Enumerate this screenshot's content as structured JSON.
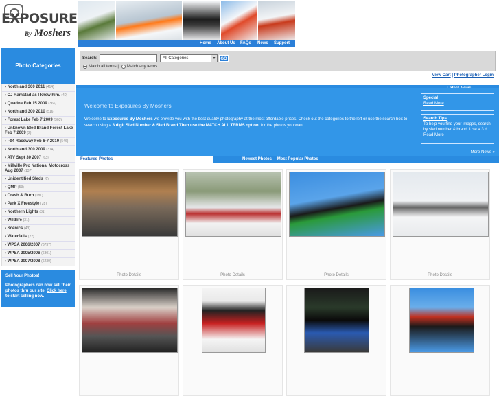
{
  "logo": {
    "line1": "EXPOSURES",
    "by": "By",
    "line2": "Moshers"
  },
  "nav": {
    "items": [
      "Home",
      "About Us",
      "FAQs",
      "News",
      "Support"
    ]
  },
  "sidebar": {
    "heading": "Photo Categories",
    "items": [
      {
        "label": "Northland 300 2011",
        "count": "(414)"
      },
      {
        "label": "CJ Ramstad as I knew him.",
        "count": "(40)"
      },
      {
        "label": "Quadna Feb 15 2009",
        "count": "(366)"
      },
      {
        "label": "Northland 300 2010",
        "count": "(516)"
      },
      {
        "label": "Forest Lake Feb 7 2009",
        "count": "(303)"
      },
      {
        "label": "Unknown Sled Brand Forest Lake Feb 7 2009",
        "count": "(2)"
      },
      {
        "label": "I-94 Raceway Feb 6-7 2010",
        "count": "(546)"
      },
      {
        "label": "Northland 300 2009",
        "count": "(314)"
      },
      {
        "label": "ATV Sept 30 2007",
        "count": "(63)"
      },
      {
        "label": "Millville Pro National Motocross Aug 2007",
        "count": "(137)"
      },
      {
        "label": "Unidentified Sleds",
        "count": "(6)"
      },
      {
        "label": "QMP",
        "count": "(53)"
      },
      {
        "label": "Crash & Burn",
        "count": "(181)"
      },
      {
        "label": "Park X Freestyle",
        "count": "(28)"
      },
      {
        "label": "Northern Lights",
        "count": "(31)"
      },
      {
        "label": "Wildlife",
        "count": "(31)"
      },
      {
        "label": "Scenics",
        "count": "(43)"
      },
      {
        "label": "Waterfalls",
        "count": "(22)"
      },
      {
        "label": "WPSA 2006/2007",
        "count": "(6737)"
      },
      {
        "label": "WPSA 2005/2006",
        "count": "(6801)"
      },
      {
        "label": "WPSA 2007/2008",
        "count": "(6230)"
      }
    ],
    "sell": {
      "title": "Sell Your Photos!",
      "text": "Photographers can now sell their photos thru our site.",
      "link": "Click here",
      "tail": "to start selling now."
    }
  },
  "search": {
    "label": "Search:",
    "value": "",
    "category": "All Categories",
    "go": "GO",
    "opt_all": "Match all terms |",
    "opt_any": "Match any terms"
  },
  "userlinks": {
    "cart": "View Cart",
    "sep": " | ",
    "login": "Photographer Login"
  },
  "news": {
    "heading": "Latest News",
    "item1_title": "Special",
    "item1_link": "Read More",
    "item2_title": "Search Tips",
    "item2_text": "To help you find your images, search by sled number & brand. Use a 3 d...",
    "item2_link": "Read More",
    "more": "More News »"
  },
  "welcome": {
    "title": "Welcome to Exposures By Moshers",
    "p_a": "Welcome to ",
    "p_b": "Exposures By Moshers",
    "p_c": " we provide you with the best quality  photography at the most affordable prices. Check out the categories to the left or use the search box to search using a ",
    "p_d": "3 digit Sled Number & Sled Brand Then use the MATCH ALL TERMS option,",
    "p_e": " for the photos you want."
  },
  "featured": {
    "label": "Featured Photos",
    "newest": "Newest Photos",
    "popular": "Most Popular Photos",
    "details": "Photo Details"
  },
  "colors": {
    "brand_blue": "#2a8be0",
    "nav_blue": "#2a7fd8",
    "link": "#1a5fb4"
  }
}
